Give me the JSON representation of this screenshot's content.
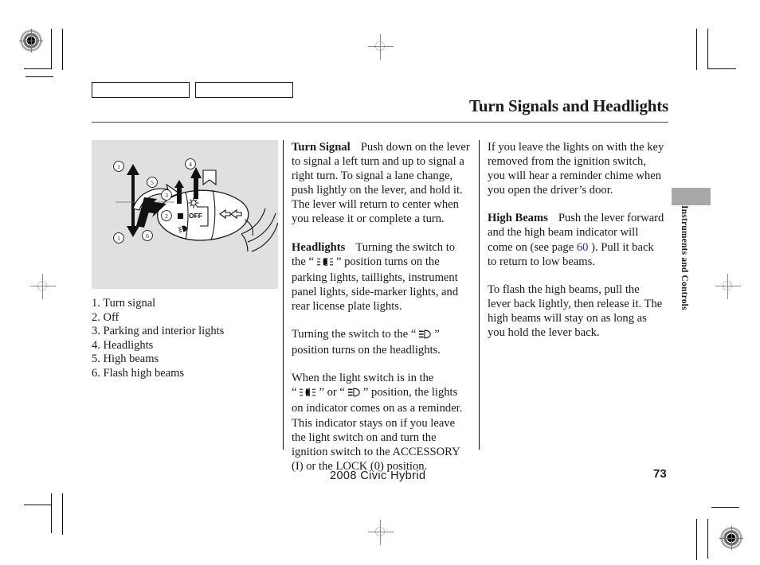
{
  "page": {
    "title": "Turn Signals and Headlights",
    "side_tab_label": "Instruments and Controls",
    "footer_model": "2008  Civic  Hybrid",
    "footer_page": "73"
  },
  "figure": {
    "name": "turn-signal-lever-illustration",
    "background_color": "#e0e0e0",
    "switch_label_off": "OFF",
    "callout_numbers": [
      "1",
      "1",
      "2",
      "3",
      "4",
      "5",
      "6"
    ]
  },
  "callouts": [
    "1. Turn signal",
    "2. Off",
    "3. Parking and interior lights",
    "4. Headlights",
    "5. High beams",
    "6. Flash high beams"
  ],
  "middle_column": {
    "turn_signal": {
      "heading": "Turn Signal",
      "body": "Push down on the lever to signal a left turn and up to signal a right turn. To signal a lane change, push lightly on the lever, and hold it. The lever will return to center when you release it or complete a turn."
    },
    "headlights": {
      "heading": "Headlights",
      "body_before_symbol": "Turning the switch to the “",
      "symbol": "parking-light-symbol",
      "body_after_symbol": "” position turns on the parking lights, taillights, instrument panel lights, side-marker lights, and rear license plate lights."
    },
    "headlight_position": {
      "before": "Turning the switch to the “",
      "symbol": "headlight-symbol",
      "after": "” position turns on the headlights."
    },
    "indicator": {
      "line1": "When the light switch is in the",
      "quote_open": "“",
      "symbol_1": "parking-light-symbol",
      "quote_or": "” or “",
      "symbol_2": "headlight-symbol",
      "after": "” position, the lights on indicator comes on as a reminder. This indicator stays on if you leave the light switch on and turn the ignition switch to the ACCESSORY (I) or the LOCK (0) position."
    }
  },
  "right_column": {
    "reminder": "If you leave the lights on with the key removed from the ignition switch, you will hear a reminder chime when you open the driver’s door.",
    "high_beams": {
      "heading": "High Beams",
      "before_link": "Push the lever forward and the high beam indicator will come on (see page ",
      "link_text": "60",
      "link_color": "#2a2ad0",
      "after_link": " ). Pull it back to return to low beams."
    },
    "flash": "To flash the high beams, pull the lever back lightly, then release it. The high beams will stay on as long as you hold the lever back."
  }
}
